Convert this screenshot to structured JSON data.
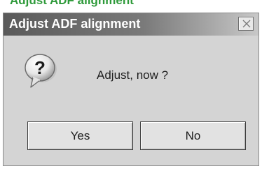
{
  "background": {
    "partial_text": "Adjust ADF alignment"
  },
  "dialog": {
    "title": "Adjust ADF alignment",
    "close_glyph": "×",
    "icon": "question-icon",
    "message": "Adjust, now ?",
    "buttons": {
      "yes_label": "Yes",
      "no_label": "No"
    }
  },
  "colors": {
    "titlebar_dark": "#5a5a5a",
    "titlebar_light": "#c8c8c8",
    "dialog_bg": "#d4d4d4",
    "background_text": "#2e9a3a"
  }
}
